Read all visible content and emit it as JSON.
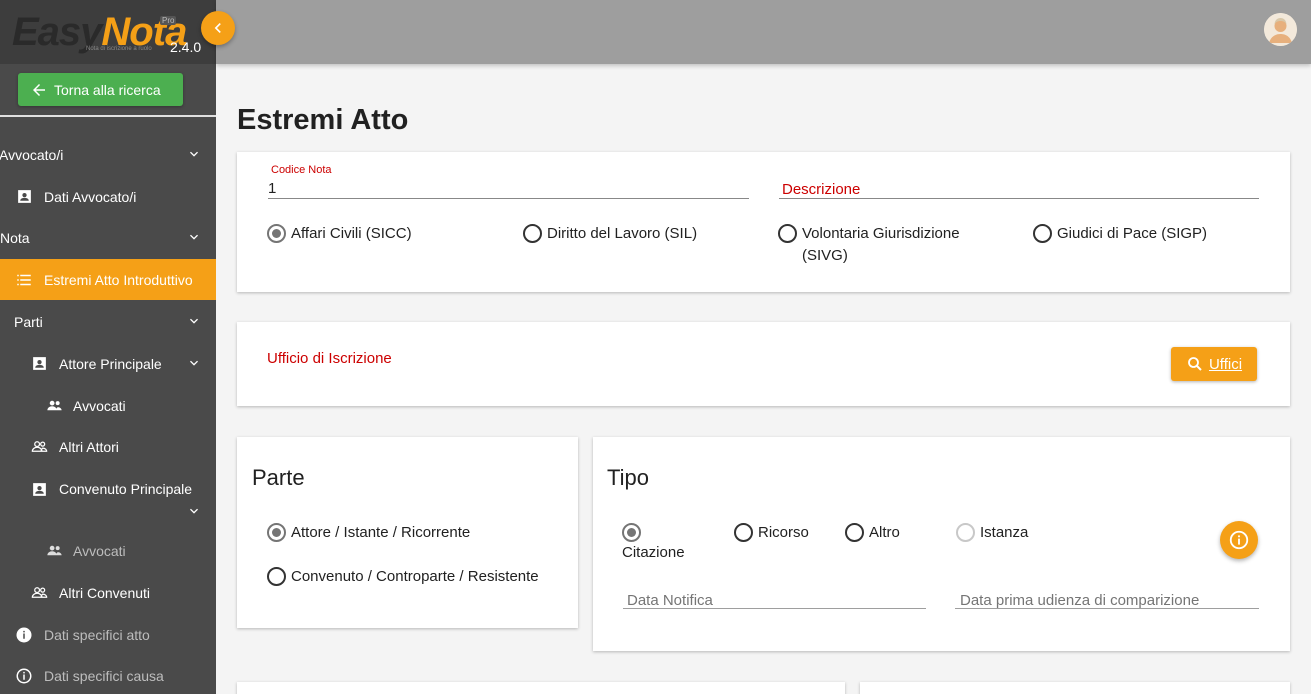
{
  "app": {
    "logo_easy": "Easy",
    "logo_nota": "Nota",
    "logo_pro": "Pro",
    "logo_tagline": "Nota di iscrizione a ruolo",
    "version": "2.4.0"
  },
  "sidebar": {
    "back_label": "Torna alla ricerca",
    "items": [
      {
        "label": "Avvocato/i",
        "icon": "chevron-down-icon"
      },
      {
        "label": "Dati Avvocato/i",
        "icon": "contact-card-icon"
      },
      {
        "label": "Nota",
        "icon": "chevron-down-icon"
      },
      {
        "label": "Estremi Atto Introduttivo",
        "icon": "list-icon",
        "active": true
      },
      {
        "label": "Parti",
        "icon": "chevron-down-icon"
      },
      {
        "label": "Attore Principale",
        "icon": "contact-card-icon"
      },
      {
        "label": "Avvocati",
        "icon": "people-icon"
      },
      {
        "label": "Altri Attori",
        "icon": "people-outline-icon"
      },
      {
        "label": "Convenuto Principale",
        "icon": "contact-card-icon"
      },
      {
        "label": "Avvocati",
        "icon": "people-icon"
      },
      {
        "label": "Altri Convenuti",
        "icon": "people-outline-icon"
      },
      {
        "label": "Dati specifici atto",
        "icon": "info-filled-icon"
      },
      {
        "label": "Dati specifici causa",
        "icon": "info-outline-icon"
      }
    ]
  },
  "main": {
    "title": "Estremi Atto",
    "card1": {
      "codice_label": "Codice Nota",
      "codice_value": "1",
      "descrizione_placeholder": "Descrizione",
      "radios": [
        {
          "label": "Affari Civili (SICC)",
          "checked": true
        },
        {
          "label": "Diritto del Lavoro (SIL)",
          "checked": false
        },
        {
          "label": "Volontaria Giurisdizione (SIVG)",
          "checked": false
        },
        {
          "label": "Giudici di Pace (SIGP)",
          "checked": false
        }
      ]
    },
    "card2": {
      "ufficio_label": "Ufficio di Iscrizione",
      "uffici_button": "Uffici"
    },
    "parte": {
      "title": "Parte",
      "radios": [
        {
          "label": "Attore / Istante / Ricorrente",
          "checked": true
        },
        {
          "label": "Convenuto / Controparte / Resistente",
          "checked": false
        }
      ]
    },
    "tipo": {
      "title": "Tipo",
      "radios": [
        {
          "label": "Citazione",
          "checked": true
        },
        {
          "label": "Ricorso",
          "checked": false
        },
        {
          "label": "Altro",
          "checked": false
        },
        {
          "label": "Istanza",
          "checked": false,
          "disabled": true
        }
      ],
      "data_notifica_placeholder": "Data Notifica",
      "data_udienza_placeholder": "Data prima udienza di comparizione"
    }
  },
  "colors": {
    "accent": "#f5a017",
    "sidebar": "#4a4a4a",
    "topbar": "#9e9e9e",
    "back_button": "#4caf50",
    "error_label": "#cc0000"
  }
}
